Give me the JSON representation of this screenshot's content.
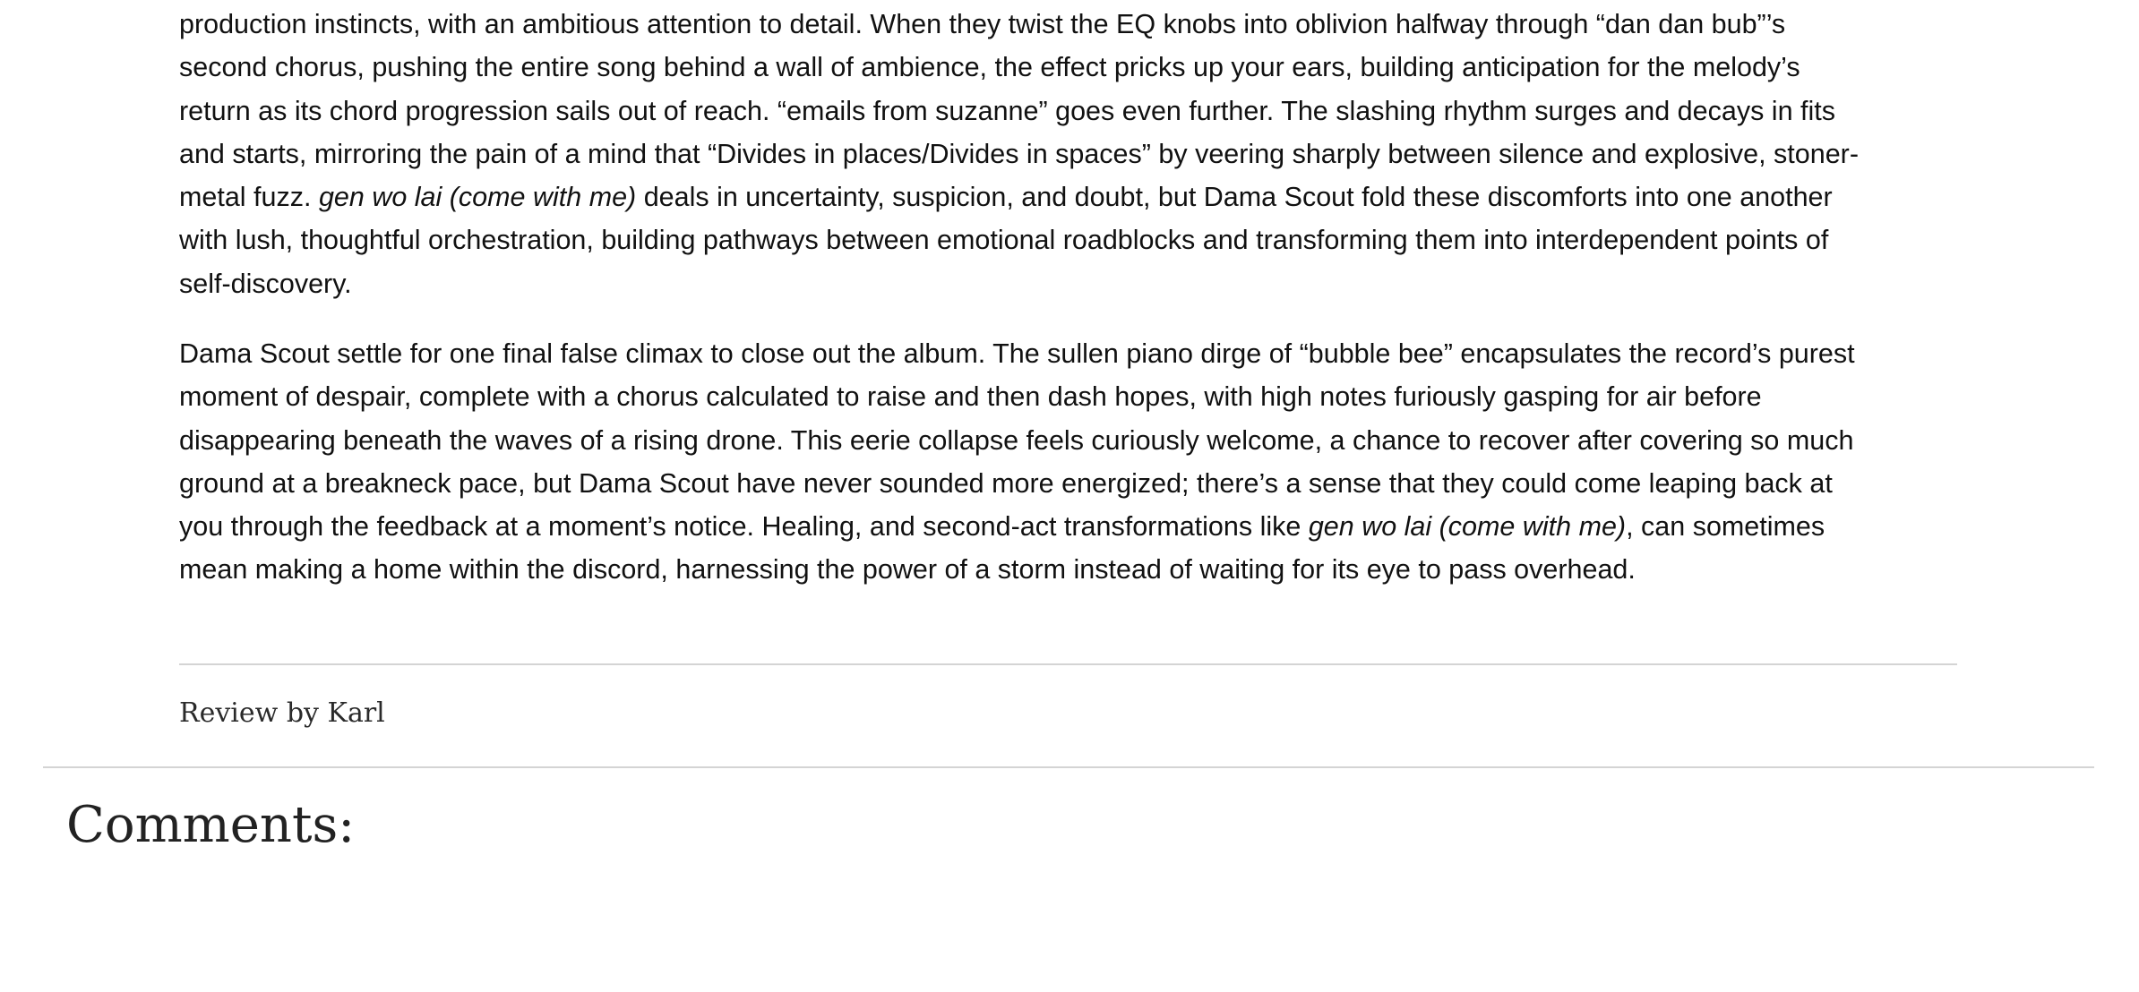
{
  "review": {
    "paragraph1": {
      "lines": [
        [
          "production instincts, with an ambitious attention to detail. When they twist the EQ knobs into oblivion halfway through “dan dan bub”’s"
        ],
        [
          "second chorus, pushing the entire song behind a wall of ambience, the effect pricks up your ears, building anticipation for the melody’s"
        ],
        [
          "return as its chord progression sails out of reach. “emails from suzanne” goes even further. The slashing rhythm surges and decays in fits"
        ],
        [
          "and starts, mirroring the pain of a mind that “Divides in places/Divides in spaces” by veering sharply between silence and explosive, stoner-"
        ],
        [
          "metal fuzz. ",
          "gen wo lai (come with me)",
          " deals in uncertainty, suspicion, and doubt, but Dama Scout fold these discomforts into one another"
        ],
        [
          "with lush, thoughtful orchestration, building pathways between emotional roadblocks and transforming them into interdependent points of"
        ],
        [
          "self-discovery."
        ]
      ]
    },
    "paragraph2": {
      "lines": [
        [
          "Dama Scout settle for one final false climax to close out the album. The sullen piano dirge of “bubble bee” encapsulates the record’s purest"
        ],
        [
          "moment of despair, complete with a chorus calculated to raise and then dash hopes, with high notes furiously gasping for air before"
        ],
        [
          "disappearing beneath the waves of a rising drone. This eerie collapse feels curiously welcome, a chance to recover after covering so much"
        ],
        [
          "ground at a breakneck pace, but Dama Scout have never sounded more energized; there’s a sense that they could come leaping back at"
        ],
        [
          "you through the feedback at a moment’s notice. Healing, and second-act transformations like ",
          "gen wo lai (come with me)",
          ", can sometimes"
        ],
        [
          "mean making a home within the discord, harnessing the power of a storm instead of waiting for its eye to pass overhead."
        ]
      ]
    },
    "byline": "Review by Karl"
  },
  "comments": {
    "title": "Comments:"
  }
}
